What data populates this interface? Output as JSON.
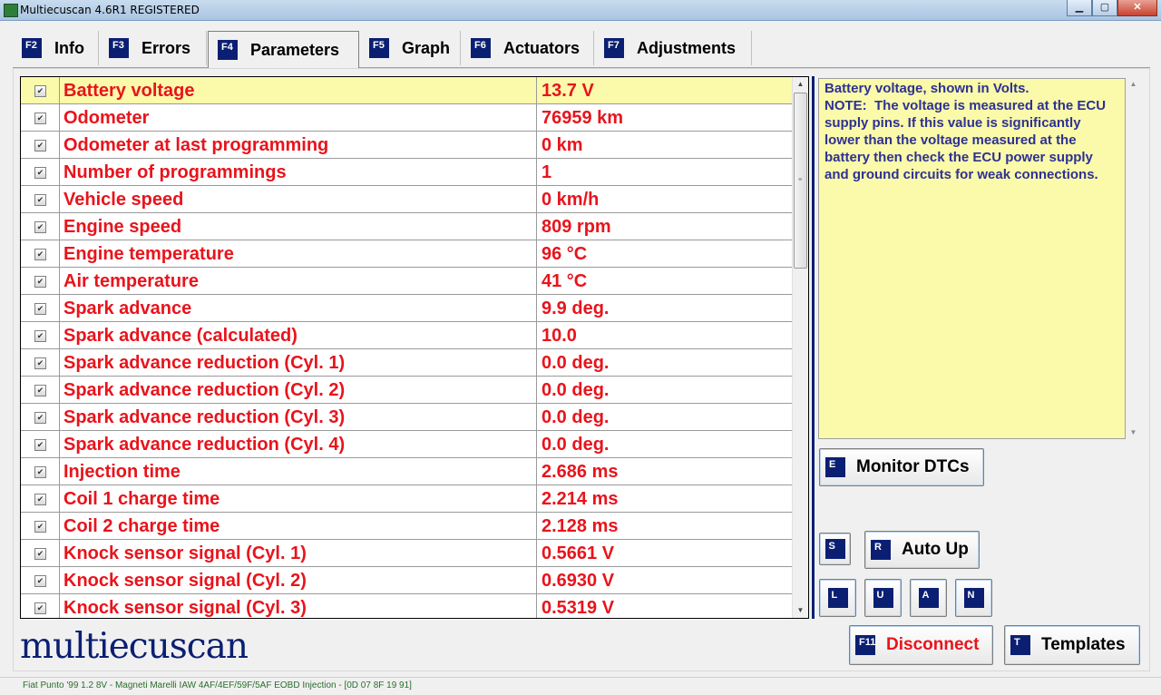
{
  "window": {
    "title": "Multiecuscan 4.6R1 REGISTERED",
    "controls": {
      "minimize": "▁",
      "maximize": "▢",
      "close": "✕"
    }
  },
  "tabs": [
    {
      "key": "F2",
      "label": "Info"
    },
    {
      "key": "F3",
      "label": "Errors"
    },
    {
      "key": "F4",
      "label": "Parameters",
      "active": true
    },
    {
      "key": "F5",
      "label": "Graph"
    },
    {
      "key": "F6",
      "label": "Actuators"
    },
    {
      "key": "F7",
      "label": "Adjustments"
    }
  ],
  "parameters": {
    "rows": [
      {
        "name": "Battery voltage",
        "value": "13.7 V",
        "checked": true,
        "selected": true
      },
      {
        "name": "Odometer",
        "value": "76959 km",
        "checked": true
      },
      {
        "name": "Odometer at last programming",
        "value": "0 km",
        "checked": true
      },
      {
        "name": "Number of programmings",
        "value": "1",
        "checked": true
      },
      {
        "name": "Vehicle speed",
        "value": "0 km/h",
        "checked": true
      },
      {
        "name": "Engine speed",
        "value": "809 rpm",
        "checked": true
      },
      {
        "name": "Engine temperature",
        "value": "96 °C",
        "checked": true
      },
      {
        "name": "Air temperature",
        "value": "41 °C",
        "checked": true
      },
      {
        "name": "Spark advance",
        "value": "9.9 deg.",
        "checked": true
      },
      {
        "name": "Spark advance (calculated)",
        "value": "10.0",
        "checked": true
      },
      {
        "name": "Spark advance reduction (Cyl. 1)",
        "value": "0.0 deg.",
        "checked": true
      },
      {
        "name": "Spark advance reduction (Cyl. 2)",
        "value": "0.0 deg.",
        "checked": true
      },
      {
        "name": "Spark advance reduction (Cyl. 3)",
        "value": "0.0 deg.",
        "checked": true
      },
      {
        "name": "Spark advance reduction (Cyl. 4)",
        "value": "0.0 deg.",
        "checked": true
      },
      {
        "name": "Injection time",
        "value": "2.686 ms",
        "checked": true
      },
      {
        "name": "Coil 1 charge time",
        "value": "2.214 ms",
        "checked": true
      },
      {
        "name": "Coil 2 charge time",
        "value": "2.128 ms",
        "checked": true
      },
      {
        "name": "Knock sensor signal (Cyl. 1)",
        "value": "0.5661 V",
        "checked": true
      },
      {
        "name": "Knock sensor signal (Cyl. 2)",
        "value": "0.6930 V",
        "checked": true
      },
      {
        "name": "Knock sensor signal (Cyl. 3)",
        "value": "0.5319 V",
        "checked": true
      }
    ],
    "scroll_position": 0.0
  },
  "description": {
    "text": "Battery voltage, shown in Volts.\nNOTE:  The voltage is measured at the ECU supply pins. If this value is significantly lower than the voltage measured at the battery then check the ECU power supply and ground circuits for weak connections."
  },
  "buttons": {
    "monitor_dtcs": {
      "key": "E",
      "label": "Monitor DTCs"
    },
    "s": {
      "key": "S"
    },
    "auto_up": {
      "key": "R",
      "label": "Auto Up"
    },
    "l": {
      "key": "L"
    },
    "u": {
      "key": "U"
    },
    "a": {
      "key": "A"
    },
    "n": {
      "key": "N"
    },
    "disconnect": {
      "key": "F11",
      "label": "Disconnect"
    },
    "templates": {
      "key": "T",
      "label": "Templates"
    }
  },
  "logo": {
    "text": "multiecuscan"
  },
  "status": {
    "text": "Fiat Punto '99 1.2 8V - Magneti Marelli IAW 4AF/4EF/59F/5AF EOBD Injection - [0D 07 8F 19 91]"
  },
  "colors": {
    "param_text": "#e8141c",
    "selected_row": "#fafaaa",
    "description_text": "#2e3192",
    "fkey_badge": "#0b1f72",
    "status_text": "#2a6e2a"
  }
}
